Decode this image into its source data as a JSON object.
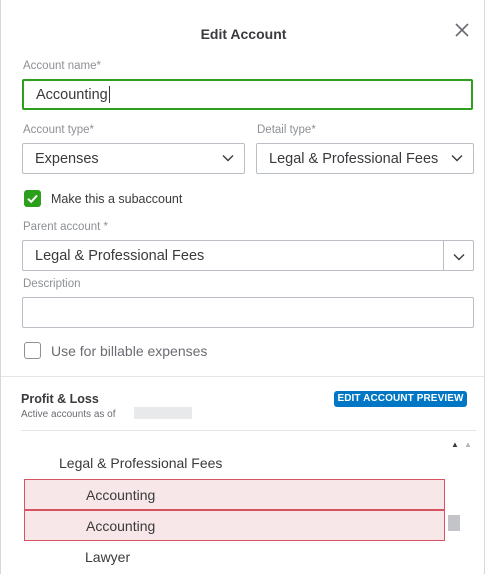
{
  "dialog": {
    "title": "Edit Account",
    "close_icon": "close-icon"
  },
  "form": {
    "account_name_label": "Account name*",
    "account_name_value": "Accounting",
    "account_type_label": "Account type*",
    "account_type_value": "Expenses",
    "detail_type_label": "Detail type*",
    "detail_type_value": "Legal & Professional Fees",
    "subaccount_checked": true,
    "subaccount_label": "Make this a subaccount",
    "parent_account_label": "Parent account *",
    "parent_account_value": "Legal & Professional Fees",
    "description_label": "Description",
    "description_value": "",
    "billable_checked": false,
    "billable_label": "Use for billable expenses"
  },
  "preview": {
    "title": "Profit & Loss",
    "subtitle": "Active accounts as of",
    "badge": "EDIT ACCOUNT PREVIEW",
    "items": [
      {
        "label": "Legal & Professional Fees",
        "highlighted": false
      },
      {
        "label": "Accounting",
        "highlighted": true
      },
      {
        "label": "Accounting",
        "highlighted": true
      },
      {
        "label": "Lawyer",
        "highlighted": false
      }
    ]
  },
  "colors": {
    "accent_green": "#2ca01c",
    "badge_blue": "#0077c5",
    "highlight_border": "#d5545f",
    "highlight_fill": "#f8e7e8"
  }
}
